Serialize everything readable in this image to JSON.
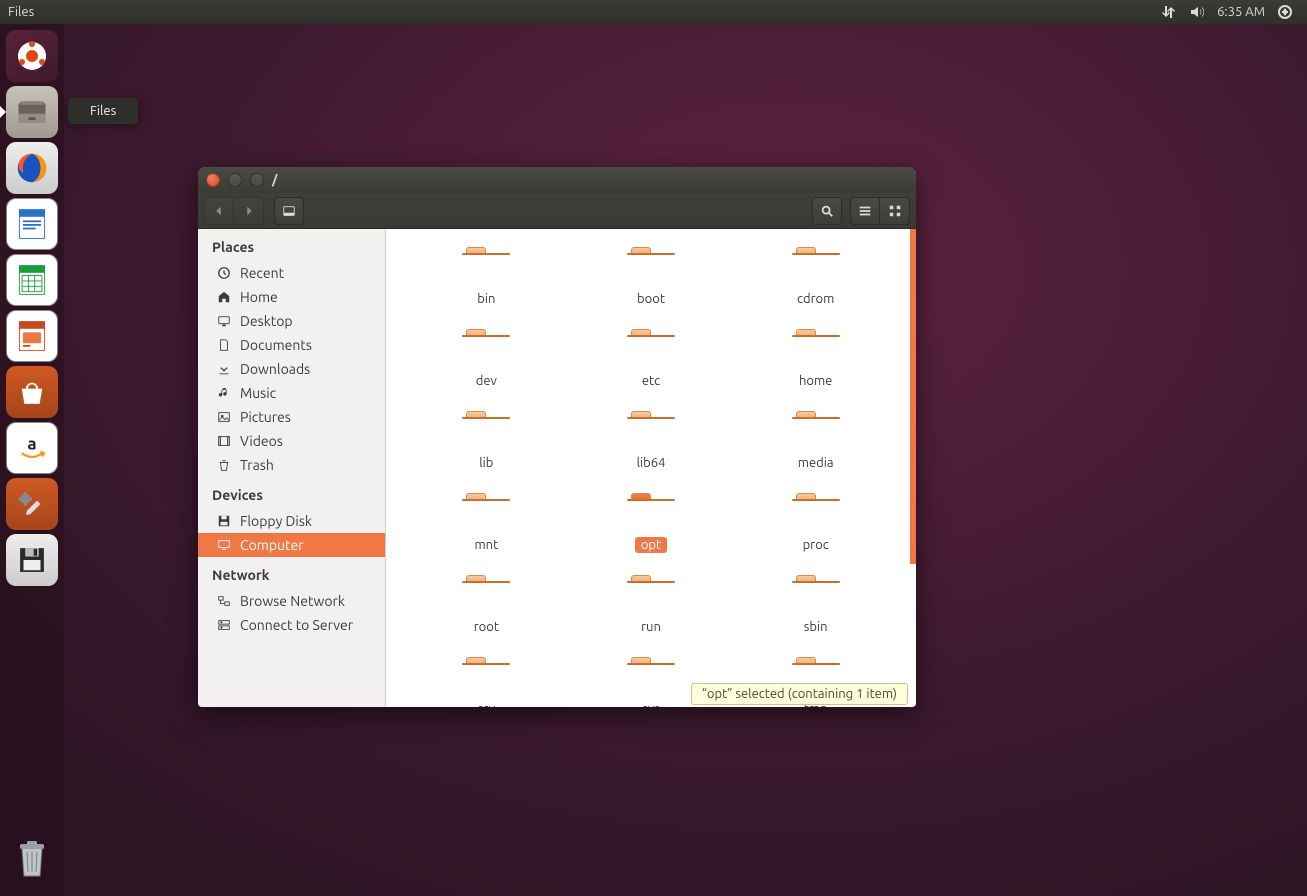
{
  "menubar": {
    "app": "Files",
    "clock": "6:35 AM"
  },
  "launcher": {
    "tooltip": "Files",
    "items": [
      {
        "name": "dash"
      },
      {
        "name": "files",
        "active": true
      },
      {
        "name": "firefox"
      },
      {
        "name": "writer"
      },
      {
        "name": "calc"
      },
      {
        "name": "impress"
      },
      {
        "name": "software"
      },
      {
        "name": "amazon"
      },
      {
        "name": "settings"
      },
      {
        "name": "floppy"
      }
    ]
  },
  "window": {
    "title": "/",
    "toolbar": {
      "path": "/"
    },
    "sidebar": {
      "sections": [
        {
          "heading": "Places",
          "items": [
            {
              "icon": "clock",
              "label": "Recent"
            },
            {
              "icon": "home",
              "label": "Home"
            },
            {
              "icon": "desktop",
              "label": "Desktop"
            },
            {
              "icon": "doc",
              "label": "Documents"
            },
            {
              "icon": "download",
              "label": "Downloads"
            },
            {
              "icon": "music",
              "label": "Music"
            },
            {
              "icon": "pictures",
              "label": "Pictures"
            },
            {
              "icon": "videos",
              "label": "Videos"
            },
            {
              "icon": "trash",
              "label": "Trash"
            }
          ]
        },
        {
          "heading": "Devices",
          "items": [
            {
              "icon": "floppy",
              "label": "Floppy Disk"
            },
            {
              "icon": "computer",
              "label": "Computer",
              "selected": true
            }
          ]
        },
        {
          "heading": "Network",
          "items": [
            {
              "icon": "network",
              "label": "Browse Network"
            },
            {
              "icon": "server",
              "label": "Connect to Server"
            }
          ]
        }
      ]
    },
    "folders": [
      "bin",
      "boot",
      "cdrom",
      "dev",
      "etc",
      "home",
      "lib",
      "lib64",
      "media",
      "mnt",
      "opt",
      "proc",
      "root",
      "run",
      "sbin",
      "srv",
      "sys",
      "tmp"
    ],
    "selected_folder": "opt",
    "status": "“opt” selected  (containing 1 item)"
  }
}
